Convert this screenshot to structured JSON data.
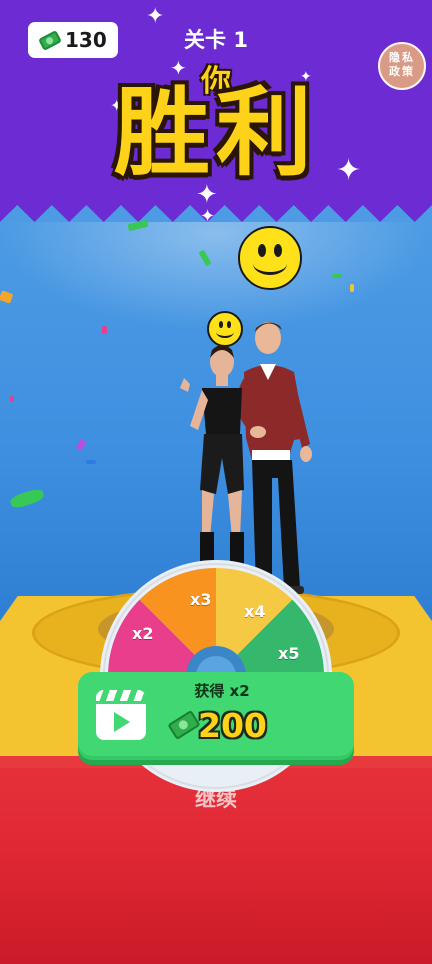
{
  "hud": {
    "money": "130",
    "level_title": "关卡 1",
    "privacy_label_line1": "隐私",
    "privacy_label_line2": "政策"
  },
  "banner": {
    "line1": "你",
    "line2": "胜利"
  },
  "wheel": {
    "segments": [
      {
        "label": "x2",
        "color": "#e83e8c"
      },
      {
        "label": "x3",
        "color": "#f7931e"
      },
      {
        "label": "x4",
        "color": "#f6c944"
      },
      {
        "label": "x5",
        "color": "#35b86b"
      }
    ]
  },
  "reward": {
    "label": "获得 x2",
    "amount": "200"
  },
  "continue_label": "继续",
  "colors": {
    "banner_purple": "#6c2bd3",
    "title_yellow": "#ffd21a",
    "reward_green": "#41d773",
    "carpet_red": "#e5303a",
    "platform_yellow": "#f4c430"
  },
  "icons": {
    "money": "cash-icon",
    "video": "video-ad-icon"
  }
}
